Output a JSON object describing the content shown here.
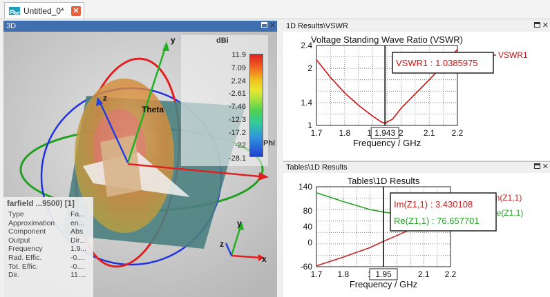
{
  "tab": {
    "title": "Untitled_0*"
  },
  "view3d": {
    "header": "3D",
    "axes": {
      "x": "x",
      "y": "y",
      "z": "z"
    },
    "theta_label": "Theta",
    "phi_label": "Phi",
    "colorbar": {
      "unit": "dBi",
      "ticks": [
        "11.9",
        "7.09",
        "2.24",
        "-2.61",
        "-7.46",
        "-12.3",
        "-17.2",
        "-22",
        "-28.1"
      ]
    },
    "properties": {
      "title": "farfield ...9500) [1]",
      "rows": [
        {
          "key": "Type",
          "value": "Fa..."
        },
        {
          "key": "Approximation",
          "value": "en..."
        },
        {
          "key": "Component",
          "value": "Abs"
        },
        {
          "key": "Output",
          "value": "Dir..."
        },
        {
          "key": "Frequency",
          "value": "1.9..."
        },
        {
          "key": "Rad. Effic.",
          "value": "-0...."
        },
        {
          "key": "Tot. Effic.",
          "value": "-0...."
        },
        {
          "key": "Dir.",
          "value": "11...."
        }
      ]
    }
  },
  "result1": {
    "header": "1D Results\\VSWR",
    "legend": "VSWR1",
    "marker_box": "VSWR1 : 1.0385975",
    "marker_x_label": "1.943",
    "chart_data": {
      "type": "line",
      "title": "Voltage Standing Wave Ratio (VSWR)",
      "xlabel": "Frequency / GHz",
      "ylabel": "",
      "xlim": [
        1.7,
        2.2
      ],
      "ylim": [
        1.0,
        2.4
      ],
      "xticks": [
        "1.7",
        "1.8",
        "1.9",
        "2",
        "2.1",
        "2.2"
      ],
      "yticks": [
        "1",
        "1.4",
        "2",
        "2.4"
      ],
      "marker_x": 1.943,
      "series": [
        {
          "name": "VSWR1",
          "color": "#d01010",
          "x": [
            1.7,
            1.75,
            1.8,
            1.85,
            1.9,
            1.93,
            1.943,
            1.97,
            2.0,
            2.05,
            2.1,
            2.15,
            2.2
          ],
          "y": [
            2.15,
            1.84,
            1.57,
            1.35,
            1.16,
            1.06,
            1.04,
            1.11,
            1.3,
            1.55,
            1.8,
            2.06,
            2.33
          ]
        }
      ]
    }
  },
  "result2": {
    "header": "Tables\\1D Results",
    "legend_im": "Im(Z1,1)",
    "legend_re": "Re(Z1,1)",
    "marker_im": "Im(Z1,1) : 3.430108",
    "marker_re": "Re(Z1,1) : 76.657701",
    "marker_x_label": "1.95",
    "chart_data": {
      "type": "line",
      "title": "Tables\\1D Results",
      "xlabel": "Frequency / GHz",
      "ylabel": "",
      "xlim": [
        1.7,
        2.2
      ],
      "ylim": [
        -60,
        140
      ],
      "xticks": [
        "1.7",
        "1.8",
        "1",
        "2.1",
        "2.2"
      ],
      "yticks": [
        "140",
        "80",
        "40",
        "0",
        "-60"
      ],
      "marker_x": 1.95,
      "series": [
        {
          "name": "Im(Z1,1)",
          "color": "#c02020",
          "x": [
            1.7,
            1.8,
            1.9,
            1.95,
            2.0,
            2.1,
            2.2
          ],
          "y": [
            -58,
            -36,
            -12,
            3.43,
            18,
            48,
            80
          ]
        },
        {
          "name": "Re(Z1,1)",
          "color": "#20a020",
          "x": [
            1.7,
            1.8,
            1.9,
            1.95,
            2.0,
            2.1,
            2.2
          ],
          "y": [
            125,
            103,
            83,
            76.66,
            72,
            70,
            74
          ]
        }
      ]
    }
  }
}
